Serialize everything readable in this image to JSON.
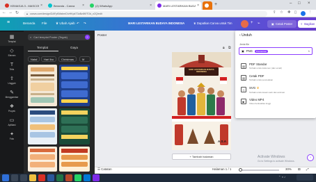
{
  "browser": {
    "tabs": [
      {
        "title": "KEMASJA 3 - MASCOMO OFFI…",
        "color": "#d93025",
        "active": false
      },
      {
        "title": "Beranda - Canva",
        "color": "#00c4cc",
        "active": false
      },
      {
        "title": "(2) WhatsApp",
        "color": "#25d366",
        "active": false
      },
      {
        "title": "MARI LESTARIKAN BUDAYA INDO…",
        "color": "#7d2ae8",
        "active": true
      },
      {
        "title": "",
        "color": "#e8710a",
        "active": false
      }
    ],
    "url": "canva.com/design/DAFyKMabmD/vHKpkT3oBz8KfTOd_n2Q/edit"
  },
  "header": {
    "menu_icon": "≡",
    "home": "Beranda",
    "file": "File",
    "resize": "Ubah Ajaib",
    "title": "MARI LESTARIKAN BUDAYA INDONESIA",
    "pro_cta": "Dapatkan Canva untuk Tim",
    "print": "Cetak Poster",
    "share": "Bagikan"
  },
  "rail": [
    {
      "icon": "▦",
      "label": "Templat"
    },
    {
      "icon": "◇",
      "label": "Elemen"
    },
    {
      "icon": "T",
      "label": "Teks"
    },
    {
      "icon": "⇪",
      "label": "Unggah"
    },
    {
      "icon": "✎",
      "label": "Menggambar"
    },
    {
      "icon": "❖",
      "label": "Proyek"
    },
    {
      "icon": "▭",
      "label": "Aplikasi"
    },
    {
      "icon": "✦",
      "label": "Foto"
    }
  ],
  "panel": {
    "search_placeholder": "Cari templat Poster (Tegak)",
    "tab_templates": "Templat",
    "tab_styles": "Gaya",
    "chips": [
      "Natal",
      "Hari Ibu",
      "Christmas",
      "M"
    ],
    "thumbs": [
      "Mindfulness Media",
      "Metode Penerapan Gaya",
      "INFOGRAFIS DATA",
      "Manfaat dari Investasi",
      "KEBIASAAN BAIK",
      "AGENDA KELAS"
    ]
  },
  "workspace": {
    "page_label": "Poster",
    "add_page": "+ Tambah halaman",
    "poster_title": "MARI LESTARIKAN BUDAYA INDONESIA",
    "poster_signature": "A.S.A",
    "notes": "Catatan",
    "page_indicator": "Halaman 1 / 1",
    "zoom": "30%"
  },
  "download": {
    "back": "Unduh",
    "file_type_label": "Jenis file",
    "selected_type": "PNG",
    "selected_badge": "Disarankan",
    "options": [
      {
        "name": "PDF Standar",
        "desc": "Terbaik untuk dokumen (dan email)"
      },
      {
        "name": "Cetak PDF",
        "desc": "Terbaik untuk pencetakan"
      },
      {
        "name": "SVG",
        "desc": "Terbaik untuk desain web dan animasi"
      },
      {
        "name": "Video MP4",
        "desc": "Video berkualitas tinggi"
      }
    ]
  },
  "watermark": {
    "line1": "Activate Windows",
    "line2": "Go to Settings to activate Windows."
  }
}
